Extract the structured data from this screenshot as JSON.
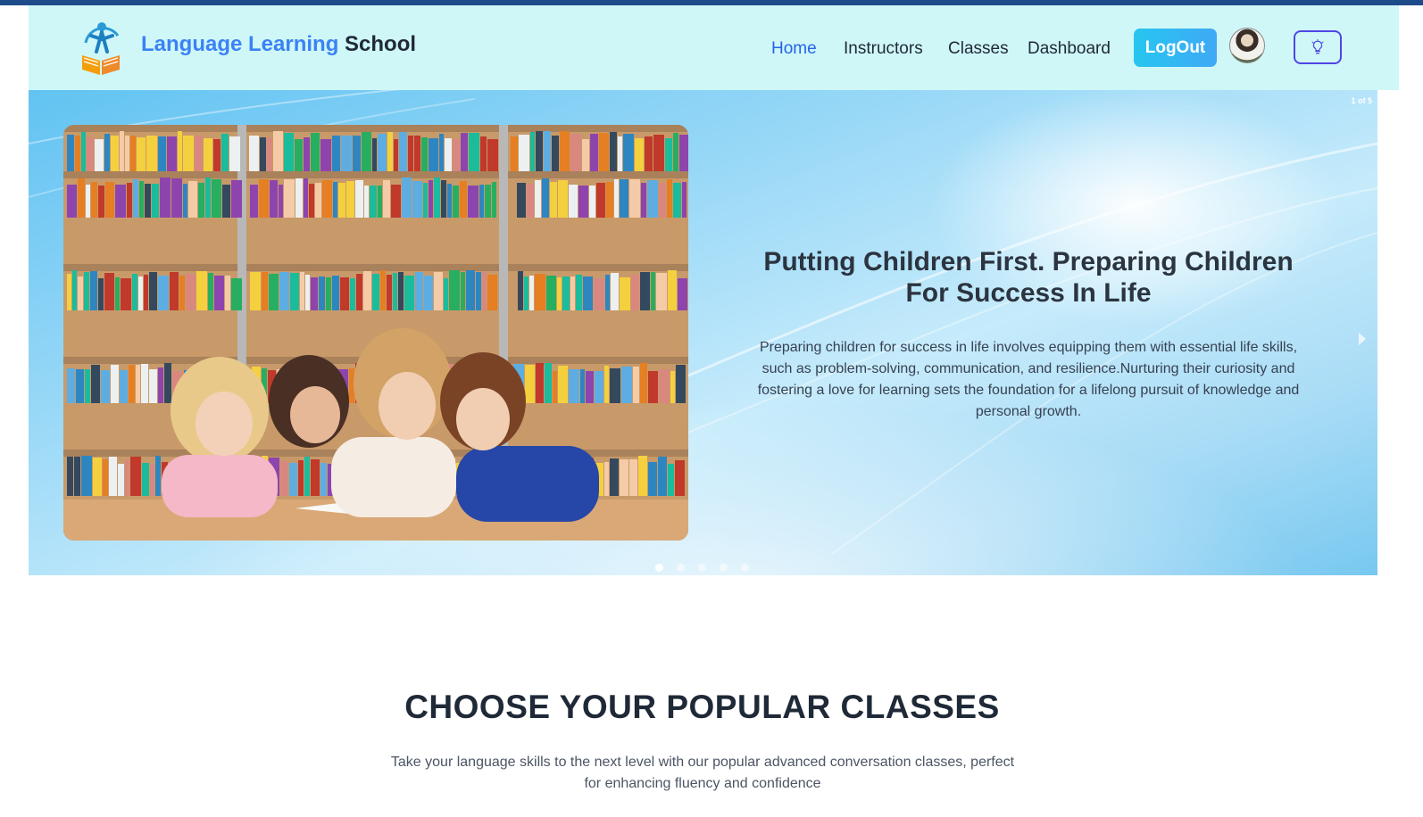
{
  "header": {
    "brand_part1": "Language Learning",
    "brand_part2": "School",
    "nav": [
      "Home",
      "Instructors",
      "Classes",
      "Dashboard"
    ],
    "logout_label": "LogOut",
    "theme_icon": "lightbulb-icon"
  },
  "hero": {
    "slide_counter": "1 of 5",
    "title": "Putting Children First. Preparing Children For Success In Life",
    "description": "Preparing children for success in life involves equipping them with essential life skills, such as problem-solving, communication, and resilience.Nurturing their curiosity and fostering a love for learning sets the foundation for a lifelong pursuit of knowledge and personal growth.",
    "slide_count": 5,
    "active_slide": 1
  },
  "classes_section": {
    "title": "CHOOSE YOUR POPULAR CLASSES",
    "description": "Take your language skills to the next level with our popular advanced conversation classes, perfect for enhancing fluency and confidence"
  },
  "colors": {
    "navbar_bg": "#cff7f7",
    "brand_accent": "#3b82f6",
    "active_nav": "#2563eb",
    "logout_bg": "#26c6f0"
  }
}
